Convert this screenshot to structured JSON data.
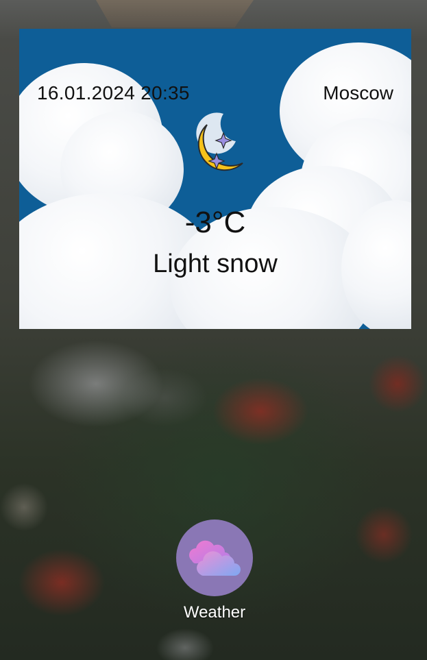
{
  "widget": {
    "datetime": "16.01.2024 20:35",
    "city": "Moscow",
    "temperature": "-3°C",
    "condition": "Light snow",
    "icon": "moon-stars-icon"
  },
  "app": {
    "label": "Weather",
    "icon": "cloud-icon"
  },
  "colors": {
    "sky": "#0e5e97",
    "moon": "#f6c21a",
    "star": "#9a8fe0",
    "app_icon_bg": "#8a77b5"
  }
}
